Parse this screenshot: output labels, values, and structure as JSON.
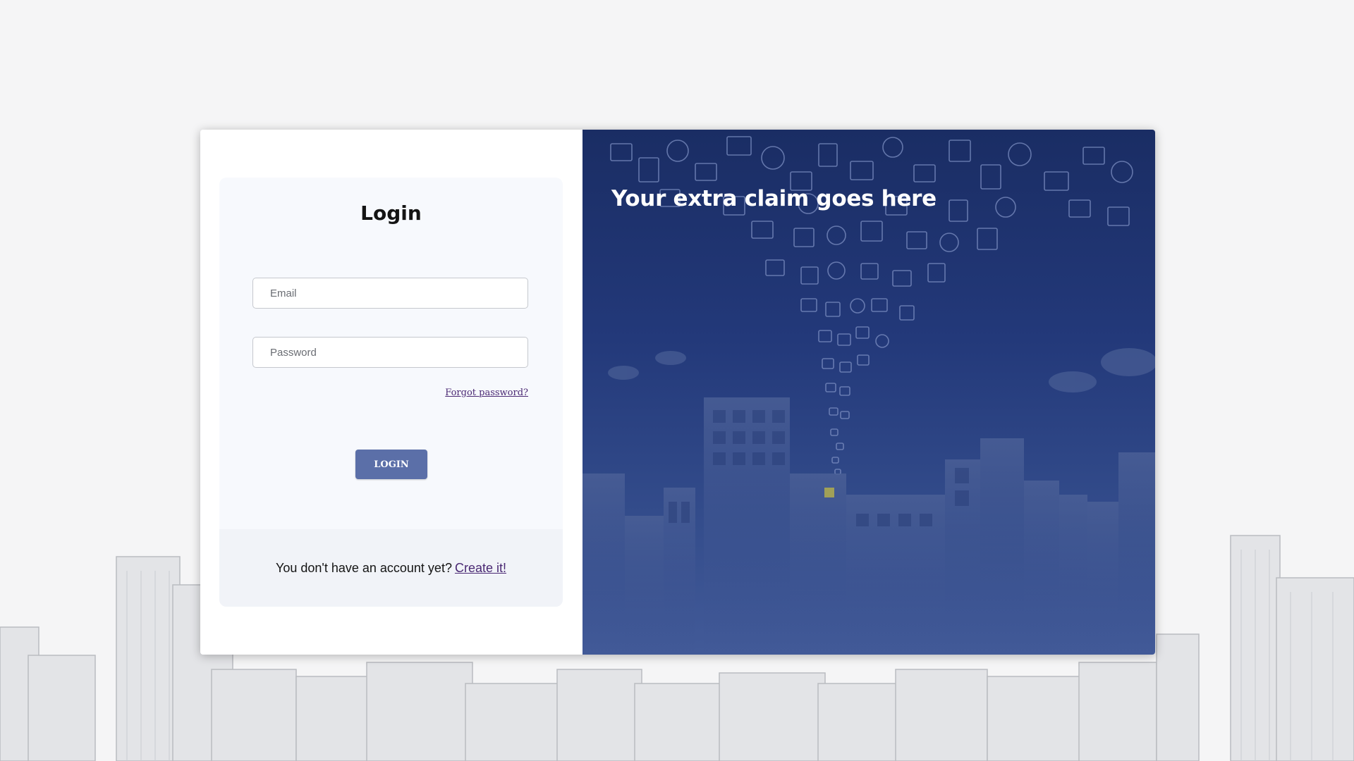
{
  "login": {
    "title": "Login",
    "email_placeholder": "Email",
    "password_placeholder": "Password",
    "forgot_link": "Forgot password?",
    "login_button": "LOGIN"
  },
  "signup": {
    "prompt": "You don't have an account yet?",
    "link": "Create it!"
  },
  "promo": {
    "claim": "Your extra claim goes here"
  },
  "colors": {
    "accent_button": "#5b6fa8",
    "link": "#4a2873",
    "promo_background": "#1a2d64"
  }
}
